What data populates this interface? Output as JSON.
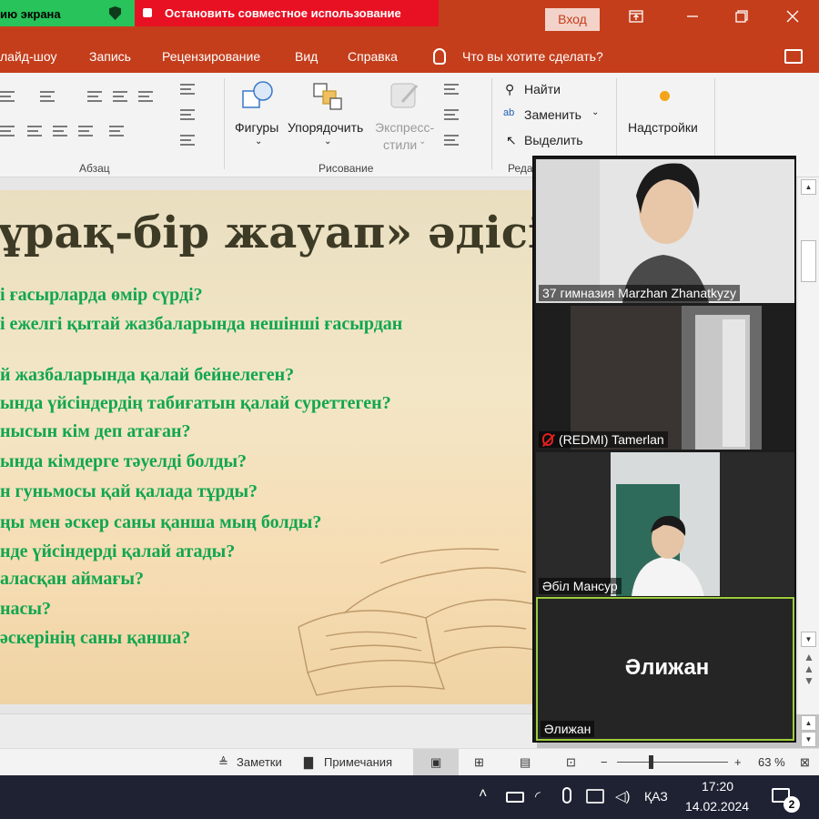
{
  "titlebar": {
    "share_partial": "ию экрана",
    "stop_share": "Остановить совместное использование",
    "login": "Вход"
  },
  "menu": {
    "items": [
      "лайд-шоу",
      "Запись",
      "Рецензирование",
      "Вид",
      "Справка"
    ],
    "search_hint": "Что вы хотите сделать?"
  },
  "ribbon": {
    "paragraph_group": "Абзац",
    "drawing_group": "Рисование",
    "editing_group_partial": "Реда",
    "shapes": "Фигуры",
    "arrange": "Упорядочить",
    "quick_styles_1": "Экспресс-",
    "quick_styles_2": "стили",
    "find": "Найти",
    "replace": "Заменить",
    "select": "Выделить",
    "addins": "Надстройки"
  },
  "slide": {
    "title": "ұрақ-бір жауап» әдісі.",
    "questions": [
      "і ғасырларда өмір сүрді?",
      "і ежелгі қытай жазбаларында нешінші ғасырдан",
      "й жазбаларында қалай бейнелеген?",
      "ында үйсіндердің табиғатын қалай суреттеген?",
      "нысын кім деп атаған?",
      "ында кімдерге тәуелді болды?",
      "н гуньмосы қай қалада тұрды?",
      "ңы мен әскер саны қанша мың болды?",
      "нде үйсіндерді қалай атады?",
      "аласқан аймағы?",
      "насы?",
      "әскерінің саны қанша?"
    ]
  },
  "participants": [
    {
      "name": "37 гимназия Marzhan Zhanatkyzy",
      "muted": false
    },
    {
      "name": "(REDMI) Tamerlan",
      "muted": true
    },
    {
      "name": "Әбіл Мансур",
      "muted": false
    },
    {
      "name": "Әлижан",
      "muted": false,
      "avatar_text": "Әлижан"
    }
  ],
  "statusbar": {
    "notes": "Заметки",
    "comments": "Примечания",
    "zoom": "63 %",
    "zoom_level_fraction": 0.3
  },
  "taskbar": {
    "lang": "ҚАЗ",
    "time": "17:20",
    "date": "14.02.2024",
    "notifications": "2"
  },
  "colors": {
    "accent": "#c43e1c",
    "share_green": "#28c35a",
    "stop_red": "#e81123",
    "question_green": "#11a64f",
    "taskbar": "#1f2233"
  }
}
